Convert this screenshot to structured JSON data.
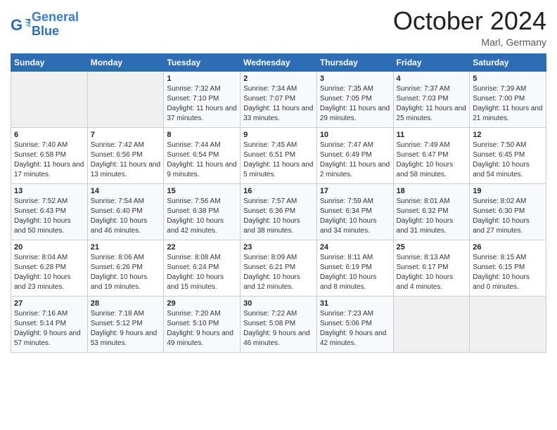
{
  "header": {
    "logo_line1": "General",
    "logo_line2": "Blue",
    "month": "October 2024",
    "location": "Marl, Germany"
  },
  "days_of_week": [
    "Sunday",
    "Monday",
    "Tuesday",
    "Wednesday",
    "Thursday",
    "Friday",
    "Saturday"
  ],
  "weeks": [
    [
      {
        "day": "",
        "detail": ""
      },
      {
        "day": "",
        "detail": ""
      },
      {
        "day": "1",
        "detail": "Sunrise: 7:32 AM\nSunset: 7:10 PM\nDaylight: 11 hours and 37 minutes."
      },
      {
        "day": "2",
        "detail": "Sunrise: 7:34 AM\nSunset: 7:07 PM\nDaylight: 11 hours and 33 minutes."
      },
      {
        "day": "3",
        "detail": "Sunrise: 7:35 AM\nSunset: 7:05 PM\nDaylight: 11 hours and 29 minutes."
      },
      {
        "day": "4",
        "detail": "Sunrise: 7:37 AM\nSunset: 7:03 PM\nDaylight: 11 hours and 25 minutes."
      },
      {
        "day": "5",
        "detail": "Sunrise: 7:39 AM\nSunset: 7:00 PM\nDaylight: 11 hours and 21 minutes."
      }
    ],
    [
      {
        "day": "6",
        "detail": "Sunrise: 7:40 AM\nSunset: 6:58 PM\nDaylight: 11 hours and 17 minutes."
      },
      {
        "day": "7",
        "detail": "Sunrise: 7:42 AM\nSunset: 6:56 PM\nDaylight: 11 hours and 13 minutes."
      },
      {
        "day": "8",
        "detail": "Sunrise: 7:44 AM\nSunset: 6:54 PM\nDaylight: 11 hours and 9 minutes."
      },
      {
        "day": "9",
        "detail": "Sunrise: 7:45 AM\nSunset: 6:51 PM\nDaylight: 11 hours and 5 minutes."
      },
      {
        "day": "10",
        "detail": "Sunrise: 7:47 AM\nSunset: 6:49 PM\nDaylight: 11 hours and 2 minutes."
      },
      {
        "day": "11",
        "detail": "Sunrise: 7:49 AM\nSunset: 6:47 PM\nDaylight: 10 hours and 58 minutes."
      },
      {
        "day": "12",
        "detail": "Sunrise: 7:50 AM\nSunset: 6:45 PM\nDaylight: 10 hours and 54 minutes."
      }
    ],
    [
      {
        "day": "13",
        "detail": "Sunrise: 7:52 AM\nSunset: 6:43 PM\nDaylight: 10 hours and 50 minutes."
      },
      {
        "day": "14",
        "detail": "Sunrise: 7:54 AM\nSunset: 6:40 PM\nDaylight: 10 hours and 46 minutes."
      },
      {
        "day": "15",
        "detail": "Sunrise: 7:56 AM\nSunset: 6:38 PM\nDaylight: 10 hours and 42 minutes."
      },
      {
        "day": "16",
        "detail": "Sunrise: 7:57 AM\nSunset: 6:36 PM\nDaylight: 10 hours and 38 minutes."
      },
      {
        "day": "17",
        "detail": "Sunrise: 7:59 AM\nSunset: 6:34 PM\nDaylight: 10 hours and 34 minutes."
      },
      {
        "day": "18",
        "detail": "Sunrise: 8:01 AM\nSunset: 6:32 PM\nDaylight: 10 hours and 31 minutes."
      },
      {
        "day": "19",
        "detail": "Sunrise: 8:02 AM\nSunset: 6:30 PM\nDaylight: 10 hours and 27 minutes."
      }
    ],
    [
      {
        "day": "20",
        "detail": "Sunrise: 8:04 AM\nSunset: 6:28 PM\nDaylight: 10 hours and 23 minutes."
      },
      {
        "day": "21",
        "detail": "Sunrise: 8:06 AM\nSunset: 6:26 PM\nDaylight: 10 hours and 19 minutes."
      },
      {
        "day": "22",
        "detail": "Sunrise: 8:08 AM\nSunset: 6:24 PM\nDaylight: 10 hours and 15 minutes."
      },
      {
        "day": "23",
        "detail": "Sunrise: 8:09 AM\nSunset: 6:21 PM\nDaylight: 10 hours and 12 minutes."
      },
      {
        "day": "24",
        "detail": "Sunrise: 8:11 AM\nSunset: 6:19 PM\nDaylight: 10 hours and 8 minutes."
      },
      {
        "day": "25",
        "detail": "Sunrise: 8:13 AM\nSunset: 6:17 PM\nDaylight: 10 hours and 4 minutes."
      },
      {
        "day": "26",
        "detail": "Sunrise: 8:15 AM\nSunset: 6:15 PM\nDaylight: 10 hours and 0 minutes."
      }
    ],
    [
      {
        "day": "27",
        "detail": "Sunrise: 7:16 AM\nSunset: 5:14 PM\nDaylight: 9 hours and 57 minutes."
      },
      {
        "day": "28",
        "detail": "Sunrise: 7:18 AM\nSunset: 5:12 PM\nDaylight: 9 hours and 53 minutes."
      },
      {
        "day": "29",
        "detail": "Sunrise: 7:20 AM\nSunset: 5:10 PM\nDaylight: 9 hours and 49 minutes."
      },
      {
        "day": "30",
        "detail": "Sunrise: 7:22 AM\nSunset: 5:08 PM\nDaylight: 9 hours and 46 minutes."
      },
      {
        "day": "31",
        "detail": "Sunrise: 7:23 AM\nSunset: 5:06 PM\nDaylight: 9 hours and 42 minutes."
      },
      {
        "day": "",
        "detail": ""
      },
      {
        "day": "",
        "detail": ""
      }
    ]
  ]
}
